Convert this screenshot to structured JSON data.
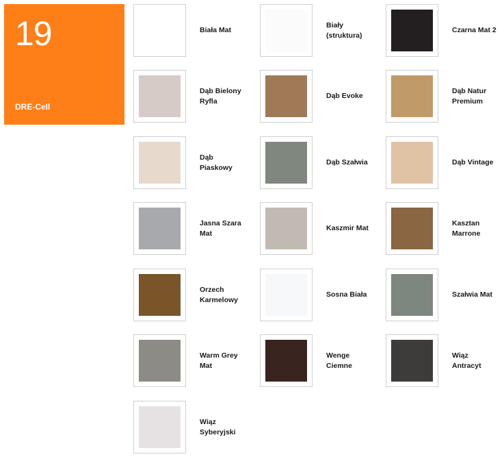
{
  "collection": {
    "number": "19",
    "name": "DRE-Cell",
    "accent_color": "#fe7f18"
  },
  "swatches": [
    {
      "name": "Biała Mat",
      "color": "#ffffff"
    },
    {
      "name": "Biały\n(struktura)",
      "color": "#fbfbfb"
    },
    {
      "name": "Czarna Mat 2",
      "color": "#231f20"
    },
    {
      "name": "Dąb Bielony\nRyfla",
      "color": "#d6cbc6"
    },
    {
      "name": "Dąb Evoke",
      "color": "#a07a56"
    },
    {
      "name": "Dąb Natur\nPremium",
      "color": "#c09a68"
    },
    {
      "name": "Dąb\nPiaskowy",
      "color": "#e7dacd"
    },
    {
      "name": "Dąb Szałwia",
      "color": "#7f877e"
    },
    {
      "name": "Dąb Vintage",
      "color": "#dfc3a4"
    },
    {
      "name": "Jasna Szara\nMat",
      "color": "#a7a9ac"
    },
    {
      "name": "Kaszmir Mat",
      "color": "#c0bab3"
    },
    {
      "name": "Kasztan\nMarrone",
      "color": "#8a6642"
    },
    {
      "name": "Orzech\nKarmelowy",
      "color": "#7a5529"
    },
    {
      "name": "Sosna Biała",
      "color": "#f7f8f9"
    },
    {
      "name": "Szałwia Mat",
      "color": "#7e877f"
    },
    {
      "name": "Warm Grey\nMat",
      "color": "#8d8b85"
    },
    {
      "name": "Wenge\nCiemne",
      "color": "#3a2420"
    },
    {
      "name": "Wiąz\nAntracyt",
      "color": "#3e3c3a"
    },
    {
      "name": "Wiąz\nSyberyjski",
      "color": "#e6e2e4"
    }
  ]
}
